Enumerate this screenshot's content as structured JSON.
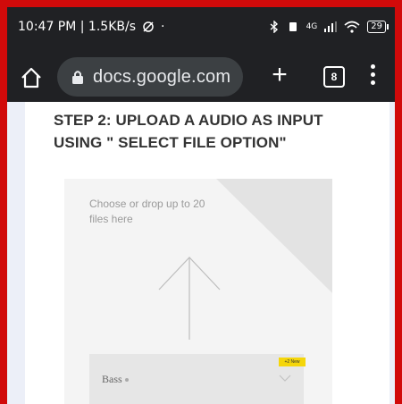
{
  "status_bar": {
    "time_speed": "10:47 PM | 1.5KB/s",
    "network_label": "4G",
    "battery": "29"
  },
  "browser": {
    "url": "docs.google.com",
    "tab_count": "8",
    "icons": [
      "home-icon",
      "lock-icon",
      "plus-icon",
      "tabs-icon",
      "menu-icon"
    ]
  },
  "content": {
    "step_title": "STEP 2: UPLOAD A AUDIO AS INPUT USING \" SELECT FILE OPTION\"",
    "drop_text": "Choose or drop up to 20 files here",
    "select_value": "Bass",
    "badge_text": "+2 New"
  }
}
